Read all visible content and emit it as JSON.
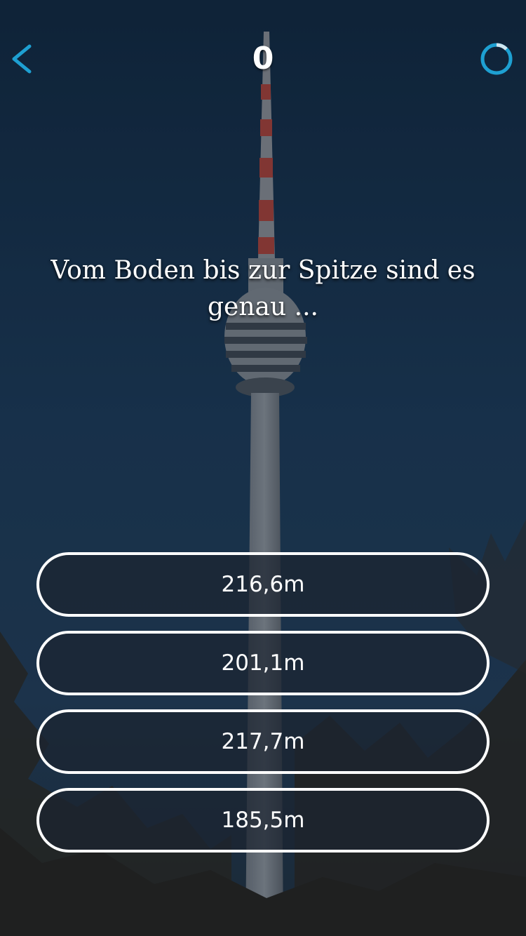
{
  "header": {
    "score": "0",
    "back_icon": "chevron-left-icon",
    "timer_icon": "circular-timer-icon",
    "accent_color": "#1ea0d2"
  },
  "question": {
    "text": "Vom Boden bis zur Spitze sind es genau ..."
  },
  "answers": [
    {
      "label": "216,6m"
    },
    {
      "label": "201,1m"
    },
    {
      "label": "217,7m"
    },
    {
      "label": "185,5m"
    }
  ],
  "background": {
    "subject": "tv-tower-photo"
  }
}
